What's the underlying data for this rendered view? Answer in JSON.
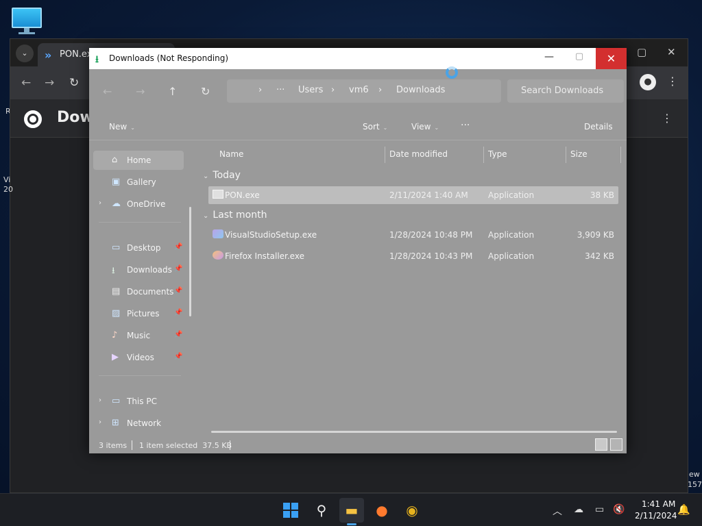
{
  "desktop": {
    "edge_texts": [
      "R",
      "Vi",
      "20",
      "ew",
      "157"
    ]
  },
  "chrome": {
    "tab_title": "PON.exe",
    "page_title": "Dow"
  },
  "explorer": {
    "title": "Downloads (Not Responding)",
    "address": {
      "more": "···",
      "parts": [
        "Users",
        "vm6",
        "Downloads"
      ]
    },
    "search_placeholder": "Search Downloads",
    "toolbar": {
      "new_label": "New",
      "sort_label": "Sort",
      "view_label": "View",
      "more_label": "···",
      "details_label": "Details"
    },
    "nav": {
      "items": [
        {
          "label": "Home",
          "icon": "home-icon"
        },
        {
          "label": "Gallery",
          "icon": "gallery-icon"
        },
        {
          "label": "OneDrive",
          "icon": "cloud-icon"
        },
        {
          "label": "Desktop",
          "icon": "desktop-icon"
        },
        {
          "label": "Downloads",
          "icon": "download-icon"
        },
        {
          "label": "Documents",
          "icon": "document-icon"
        },
        {
          "label": "Pictures",
          "icon": "pictures-icon"
        },
        {
          "label": "Music",
          "icon": "music-icon"
        },
        {
          "label": "Videos",
          "icon": "video-icon"
        },
        {
          "label": "This PC",
          "icon": "pc-icon"
        },
        {
          "label": "Network",
          "icon": "network-icon"
        }
      ]
    },
    "columns": [
      "Name",
      "Date modified",
      "Type",
      "Size"
    ],
    "groups": [
      {
        "label": "Today",
        "files": [
          {
            "name": "PON.exe",
            "date": "2/11/2024 1:40 AM",
            "type": "Application",
            "size": "38 KB",
            "selected": true
          }
        ]
      },
      {
        "label": "Last month",
        "files": [
          {
            "name": "VisualStudioSetup.exe",
            "date": "1/28/2024 10:48 PM",
            "type": "Application",
            "size": "3,909 KB",
            "selected": false
          },
          {
            "name": "Firefox Installer.exe",
            "date": "1/28/2024 10:43 PM",
            "type": "Application",
            "size": "342 KB",
            "selected": false
          }
        ]
      }
    ],
    "status": {
      "count": "3 items",
      "selection": "1 item selected  37.5 KB"
    }
  },
  "taskbar": {
    "time": "1:41 AM",
    "date": "2/11/2024"
  },
  "colors": {
    "close_red": "#d32f2f",
    "accent_blue": "#4aa3e6"
  }
}
